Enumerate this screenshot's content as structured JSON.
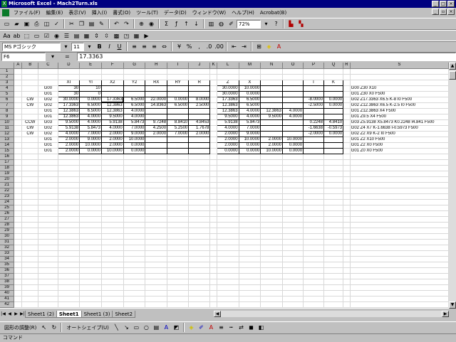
{
  "window": {
    "title": "Microsoft Excel - Mach2Turn.xls"
  },
  "menu": [
    "ファイル(F)",
    "編集(E)",
    "表示(V)",
    "挿入(I)",
    "書式(O)",
    "ツール(T)",
    "データ(D)",
    "ウィンドウ(W)",
    "ヘルプ(H)",
    "Acrobat(B)"
  ],
  "toolbar": {
    "zoom": "72%"
  },
  "format": {
    "font_name": "MS Pゴシック",
    "font_size": "11"
  },
  "formula": {
    "cell_ref": "F6",
    "equals": "=",
    "value": "17.3363"
  },
  "sheet": {
    "columns": [
      "A",
      "B",
      "C",
      "D",
      "E",
      "F",
      "G",
      "H",
      "I",
      "J",
      "K",
      "L",
      "M",
      "N",
      "O",
      "P",
      "Q",
      "R",
      "S"
    ],
    "rows": [
      [
        "",
        "",
        "",
        "",
        "",
        "",
        "",
        "",
        "",
        "",
        "",
        "",
        "",
        "",
        "",
        "",
        "",
        "",
        ""
      ],
      [
        "",
        "",
        "",
        "",
        "",
        "",
        "",
        "",
        "",
        "",
        "",
        "",
        "",
        "",
        "",
        "",
        "",
        "",
        ""
      ],
      [
        "",
        "",
        "",
        "XI",
        "YI",
        "X2",
        "Y2",
        "RX",
        "RY",
        "R",
        "",
        "Z",
        "X",
        "",
        "",
        "I",
        "K",
        "",
        ""
      ],
      [
        "",
        "",
        "G00",
        "30",
        "10",
        "",
        "",
        "",
        "",
        "",
        "",
        "30.0000",
        "10.0000",
        "",
        "",
        "",
        "",
        "",
        "G00 Z30 X10"
      ],
      [
        "",
        "",
        "G01",
        "30",
        "0",
        "",
        "",
        "",
        "",
        "",
        "",
        "30.0000",
        "0.0000",
        "",
        "",
        "",
        "",
        "",
        "G01 Z30 X0 F500"
      ],
      [
        "",
        "CW",
        "G02",
        "30.0000",
        "0.0000",
        "17.3363",
        "6.5000",
        "22.0000",
        "0.0000",
        "8.0000",
        "",
        "17.3363",
        "6.5000",
        "",
        "",
        "-8.0000",
        "0.0000",
        "",
        "G02 Z17.3363 X6.5 K-8 I0 F500"
      ],
      [
        "",
        "CW",
        "G02",
        "17.3363",
        "6.5000",
        "12.3863",
        "6.5000",
        "14.8363",
        "6.5000",
        "2.5000",
        "",
        "12.3863",
        "6.5000",
        "",
        "",
        "-2.5000",
        "0.0000",
        "",
        "G02 Z12.3863 X6.5 K-2.5 I0 F500"
      ],
      [
        "",
        "",
        "G01",
        "12.3863",
        "6.5000",
        "12.3863",
        "4.0000",
        "",
        "",
        "",
        "",
        "12.3863",
        "4.0000",
        "12.3863",
        "4.0000",
        "",
        "",
        "",
        "G01 Z12.3863 X4 F500"
      ],
      [
        "",
        "",
        "G01",
        "12.3863",
        "4.0000",
        "9.5000",
        "4.0000",
        "",
        "",
        "",
        "",
        "9.5000",
        "4.0000",
        "9.5000",
        "4.0000",
        "",
        "",
        "",
        "G01 Z9.5 X4 F500"
      ],
      [
        "",
        "CCW",
        "G03",
        "9.5000",
        "4.0000",
        "5.9138",
        "5.8473",
        "9.7248",
        "8.8410",
        "4.8453",
        "",
        "5.9138",
        "5.8473",
        "",
        "",
        "0.2248",
        "4.8410",
        "",
        "G03 Z5.9138 X5.8473 K0.2248 I4.841 F500"
      ],
      [
        "",
        "CW",
        "G02",
        "5.9138",
        "5.8473",
        "4.0000",
        "7.0000",
        "4.2500",
        "5.2500",
        "1.7678",
        "",
        "4.0000",
        "7.0000",
        "",
        "",
        "-1.6638",
        "-0.5973",
        "",
        "G02 Z4 X7 K-1.6638 I-0.5973 F500"
      ],
      [
        "",
        "CW",
        "G02",
        "4.0000",
        "7.0000",
        "2.0000",
        "9.0000",
        "2.0000",
        "7.0000",
        "2.0000",
        "",
        "2.0000",
        "9.0000",
        "",
        "",
        "-2.0000",
        "0.0000",
        "",
        "G02 Z2 X9 K-2 I0 F500"
      ],
      [
        "",
        "",
        "G01",
        "2.0000",
        "9.0000",
        "2.0000",
        "10.0000",
        "",
        "",
        "",
        "",
        "2.0000",
        "10.0000",
        "2.0000",
        "10.0000",
        "",
        "",
        "",
        "G01 Z2 X10 F500"
      ],
      [
        "",
        "",
        "G01",
        "2.0000",
        "10.0000",
        "2.0000",
        "0.0000",
        "",
        "",
        "",
        "",
        "2.0000",
        "0.0000",
        "2.0000",
        "0.0000",
        "",
        "",
        "",
        "G01 Z2 X0 F500"
      ],
      [
        "",
        "",
        "G01",
        "2.0000",
        "0.0000",
        "10.0000",
        "0.0000",
        "",
        "",
        "",
        "",
        "0.0000",
        "0.0000",
        "10.0000",
        "0.0000",
        "",
        "",
        "",
        "G01 Z0 X0 F500"
      ]
    ],
    "total_rows": 42
  },
  "tabs": [
    "Sheet1 (2)",
    "Sheet1",
    "Sheet1 (3)",
    "Sheet2"
  ],
  "active_tab": "Sheet1",
  "drawbar": {
    "draw_label": "図形の調整(R)",
    "autoshape_label": "オートシェイプ(U)"
  },
  "status": {
    "text": "コマンド"
  }
}
